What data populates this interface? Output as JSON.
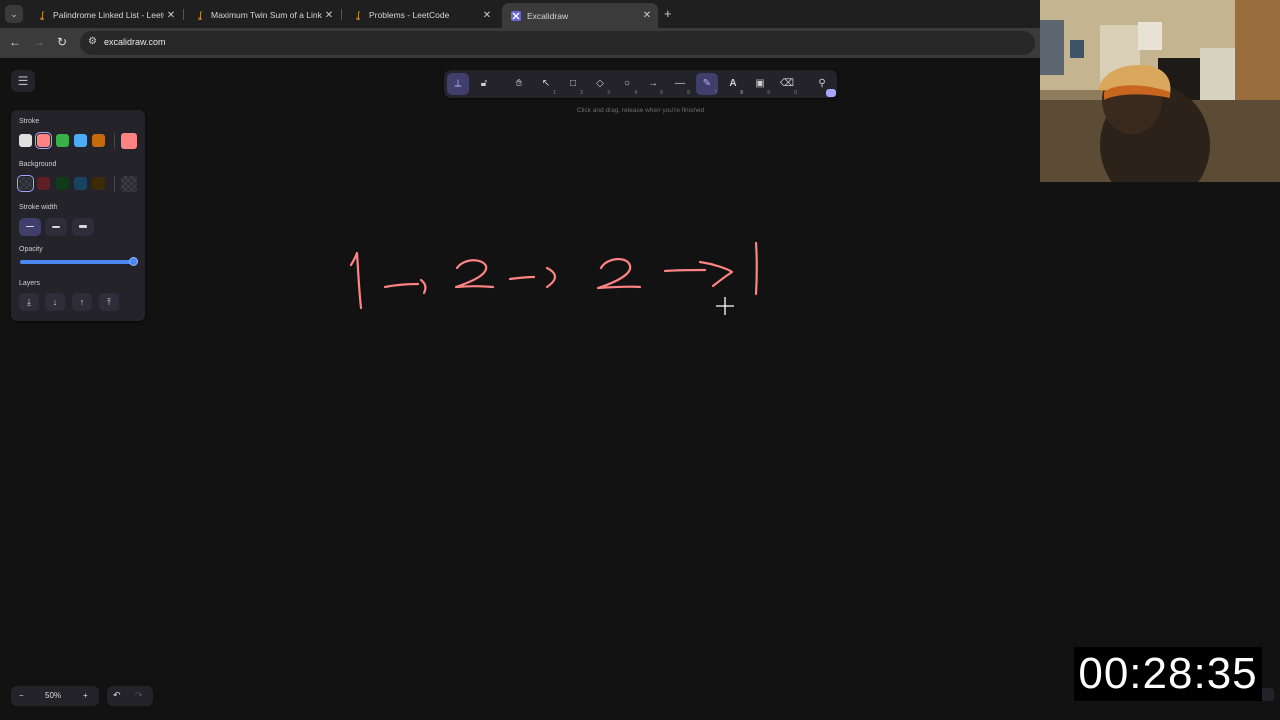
{
  "browser": {
    "tabs": [
      {
        "title": "Palindrome Linked List - LeetCo",
        "icon": "leetcode-icon",
        "active": false
      },
      {
        "title": "Maximum Twin Sum of a Linked",
        "icon": "leetcode-icon",
        "active": false
      },
      {
        "title": "Problems - LeetCode",
        "icon": "leetcode-icon",
        "active": false
      },
      {
        "title": "Excalidraw",
        "icon": "excalidraw-icon",
        "active": true
      }
    ],
    "url": "excalidraw.com"
  },
  "toolbar": {
    "tools": [
      {
        "name": "keep-selected-tool",
        "glyph": "⟂",
        "key": ""
      },
      {
        "name": "lock",
        "glyph": "🔓︎",
        "key": ""
      },
      {
        "name": "hand",
        "glyph": "✋︎",
        "key": ""
      },
      {
        "name": "selection",
        "glyph": "↖",
        "key": "1"
      },
      {
        "name": "rectangle",
        "glyph": "□",
        "key": "2"
      },
      {
        "name": "diamond",
        "glyph": "◇",
        "key": "3"
      },
      {
        "name": "ellipse",
        "glyph": "○",
        "key": "4"
      },
      {
        "name": "arrow",
        "glyph": "→",
        "key": "5"
      },
      {
        "name": "line",
        "glyph": "—",
        "key": "6"
      },
      {
        "name": "draw",
        "glyph": "✎",
        "key": "7",
        "selected": true
      },
      {
        "name": "text",
        "glyph": "A",
        "key": "8"
      },
      {
        "name": "image",
        "glyph": "▣",
        "key": "9"
      },
      {
        "name": "eraser",
        "glyph": "⌫",
        "key": "0"
      },
      {
        "name": "extra-tools",
        "glyph": "⚲",
        "key": ""
      }
    ],
    "hint": "Click and drag, release when you're finished"
  },
  "properties": {
    "stroke_label": "Stroke",
    "stroke_colors": [
      "#e0e0e0",
      "#ff8383",
      "#3bb04a",
      "#4dabf7",
      "#c66b0d"
    ],
    "stroke_current": "#ff8383",
    "background_label": "Background",
    "background_colors": [
      "transparent",
      "#5e1e24",
      "#0f3b1a",
      "#154360",
      "#3d2a06"
    ],
    "background_current": "transparent",
    "stroke_width_label": "Stroke width",
    "opacity_label": "Opacity",
    "opacity_value": 100,
    "layers_label": "Layers",
    "layer_actions": [
      "send-to-back",
      "send-backward",
      "bring-forward",
      "bring-to-front"
    ]
  },
  "footer": {
    "zoom_minus": "−",
    "zoom_level": "50%",
    "zoom_plus": "+",
    "undo": "↶",
    "redo": "↷"
  },
  "drawing": {
    "color": "#ff8383",
    "content": "1 -> 2 -> 2 -> 1"
  },
  "timer": "00:28:35"
}
